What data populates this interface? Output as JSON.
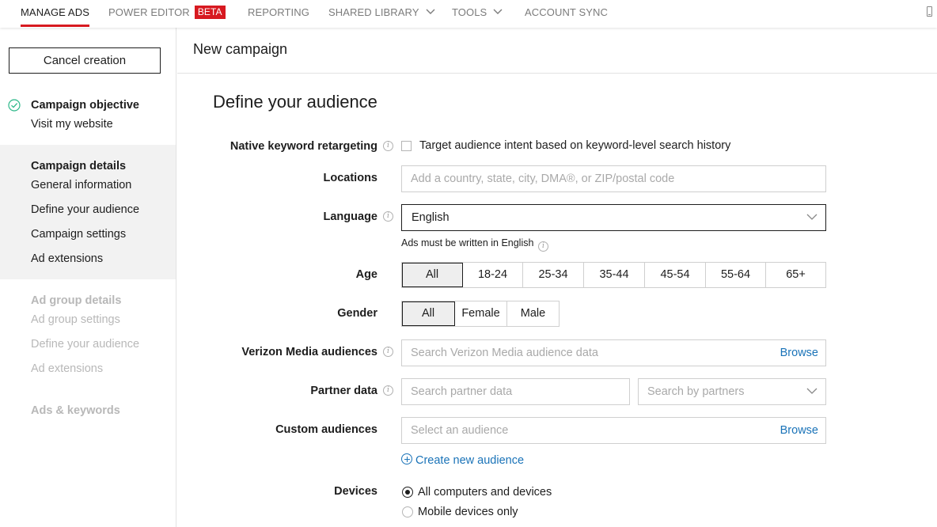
{
  "topnav": {
    "items": [
      {
        "label": "MANAGE ADS",
        "active": true
      },
      {
        "label": "POWER EDITOR",
        "badge": "BETA"
      },
      {
        "label": "REPORTING"
      },
      {
        "label": "SHARED LIBRARY",
        "dropdown": true
      },
      {
        "label": "TOOLS",
        "dropdown": true
      },
      {
        "label": "ACCOUNT SYNC"
      }
    ],
    "accent_color": "#d71920"
  },
  "sidebar": {
    "cancel_label": "Cancel creation",
    "steps": [
      {
        "title": "Campaign objective",
        "status": "complete",
        "subitems": [
          "Visit my website"
        ]
      },
      {
        "title": "Campaign details",
        "status": "active",
        "subitems": [
          "General information",
          "Define your audience",
          "Campaign settings",
          "Ad extensions"
        ]
      },
      {
        "title": "Ad group details",
        "status": "disabled",
        "subitems": [
          "Ad group settings",
          "Define your audience",
          "Ad extensions"
        ]
      },
      {
        "title": "Ads & keywords",
        "status": "disabled",
        "subitems": []
      }
    ]
  },
  "main": {
    "page_title": "New campaign",
    "section_title": "Define your audience",
    "native_keyword": {
      "label": "Native keyword retargeting",
      "checkbox_label": "Target audience intent based on keyword-level search history",
      "checked": false
    },
    "locations": {
      "label": "Locations",
      "placeholder": "Add a country, state, city, DMA®, or ZIP/postal code"
    },
    "language": {
      "label": "Language",
      "value": "English",
      "hint": "Ads must be written in English"
    },
    "age": {
      "label": "Age",
      "options": [
        "All",
        "18-24",
        "25-34",
        "35-44",
        "45-54",
        "55-64",
        "65+"
      ],
      "selected": "All"
    },
    "gender": {
      "label": "Gender",
      "options": [
        "All",
        "Female",
        "Male"
      ],
      "selected": "All"
    },
    "verizon": {
      "label": "Verizon Media audiences",
      "placeholder": "Search Verizon Media audience data",
      "browse": "Browse"
    },
    "partner": {
      "label": "Partner data",
      "placeholder": "Search partner data",
      "partners_placeholder": "Search by partners"
    },
    "custom": {
      "label": "Custom audiences",
      "placeholder": "Select an audience",
      "browse": "Browse",
      "create_link": "Create new audience"
    },
    "devices": {
      "label": "Devices",
      "options": [
        "All computers and devices",
        "Mobile devices only"
      ],
      "selected": "All computers and devices"
    },
    "link_color": "#1a73b8"
  }
}
